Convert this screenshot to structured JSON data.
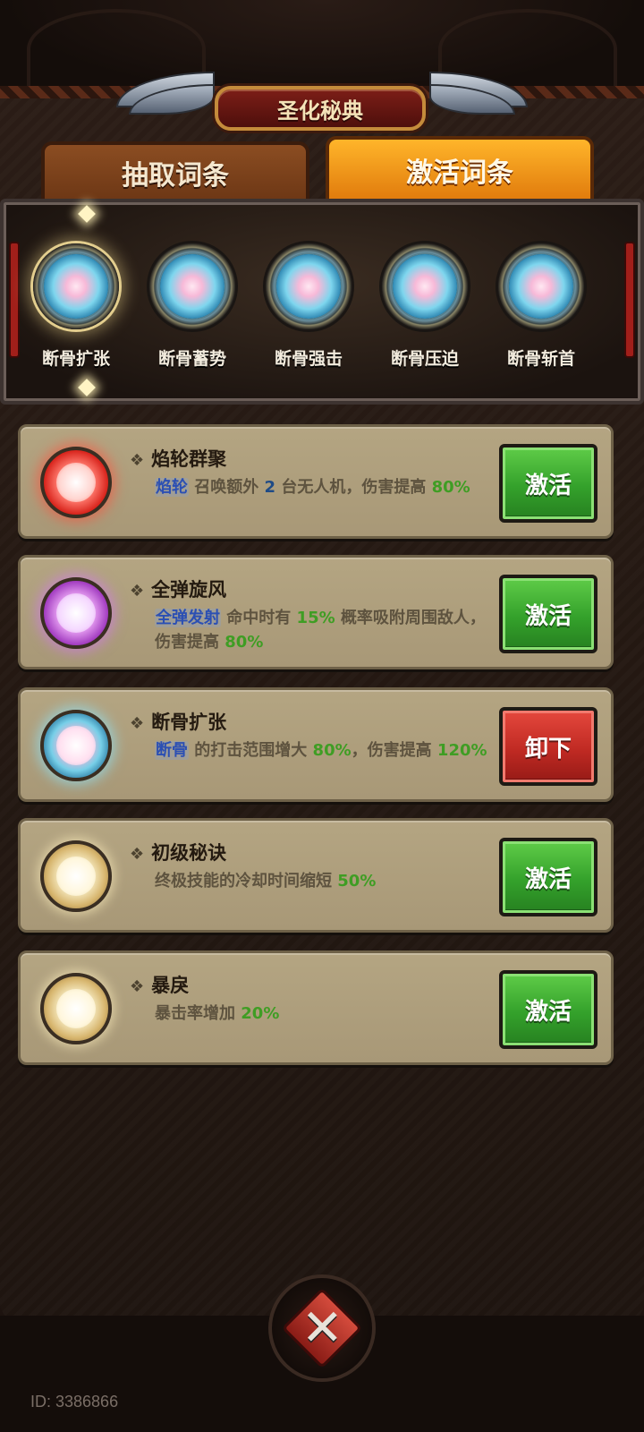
{
  "title": "圣化秘典",
  "tabs": [
    {
      "label": "抽取词条",
      "active": false
    },
    {
      "label": "激活词条",
      "active": true
    }
  ],
  "equipped_slots": [
    {
      "label": "断骨扩张",
      "active": true
    },
    {
      "label": "断骨蓄势",
      "active": false
    },
    {
      "label": "断骨强击",
      "active": false
    },
    {
      "label": "断骨压迫",
      "active": false
    },
    {
      "label": "断骨斩首",
      "active": false
    }
  ],
  "affixes": [
    {
      "name": "焰轮群聚",
      "icon": "red-orb-icon",
      "keyword": "焰轮",
      "desc_parts": [
        " 召唤额外 ",
        "2",
        " 台无人机，伤害提高 ",
        "80%"
      ],
      "button": "激活",
      "button_color": "green"
    },
    {
      "name": "全弹旋风",
      "icon": "purple-orb-icon",
      "keyword": "全弹发射",
      "desc_parts": [
        " 命中时有 ",
        "15%",
        " 概率吸附周围敌人，伤害提高 ",
        "80%"
      ],
      "button": "激活",
      "button_color": "green"
    },
    {
      "name": "断骨扩张",
      "icon": "cyan-orb-icon",
      "keyword": "断骨",
      "desc_parts": [
        " 的打击范围增大 ",
        "80%",
        "，伤害提高 ",
        "120%"
      ],
      "button": "卸下",
      "button_color": "red"
    },
    {
      "name": "初级秘诀",
      "icon": "gold-orb-icon",
      "keyword": "",
      "desc_parts": [
        "终极技能的冷却时间缩短 ",
        "50%"
      ],
      "button": "激活",
      "button_color": "green"
    },
    {
      "name": "暴戾",
      "icon": "gold-orb-icon",
      "keyword": "",
      "desc_parts": [
        "暴击率增加 ",
        "20%"
      ],
      "button": "激活",
      "button_color": "green"
    }
  ],
  "uid": "ID: 3386866",
  "colors": {
    "accent_orange": "#e07a0c",
    "button_green": "#34a12b",
    "button_red": "#c02a23",
    "keyword_blue": "#2b4fb3",
    "number_green": "#3f9d24"
  }
}
